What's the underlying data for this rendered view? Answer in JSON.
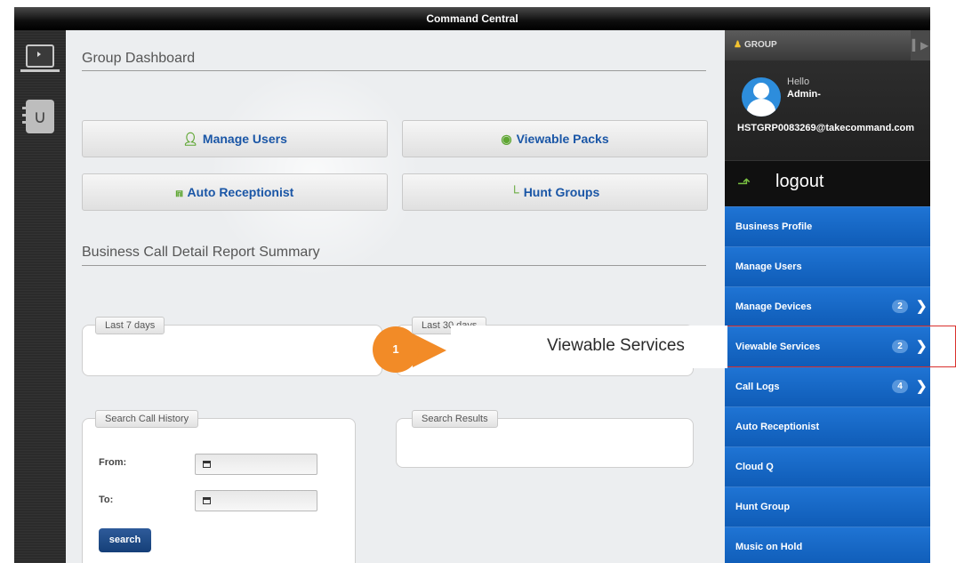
{
  "app": {
    "title": "Command Central"
  },
  "dashboard": {
    "title": "Group Dashboard",
    "buttons": [
      {
        "label": "Manage Users",
        "icon": "user-icon"
      },
      {
        "label": "Viewable Packs",
        "icon": "eye-icon"
      },
      {
        "label": "Auto Receptionist",
        "icon": "org-chart-icon"
      },
      {
        "label": "Hunt Groups",
        "icon": "hunt-group-icon"
      }
    ]
  },
  "report": {
    "title": "Business Call Detail Report Summary",
    "last7_label": "Last 7 days",
    "last30_label": "Last 30 days"
  },
  "search": {
    "panel_label": "Search Call History",
    "results_label": "Search Results",
    "from_label": "From:",
    "to_label": "To:",
    "button_label": "search"
  },
  "sidebar": {
    "header": "GROUP",
    "greeting": "Hello",
    "user_name": "Admin-",
    "email": "HSTGRP0083269@takecommand.com",
    "logout_label": "logout",
    "menu": [
      {
        "label": "Business Profile"
      },
      {
        "label": "Manage Users"
      },
      {
        "label": "Manage Devices",
        "badge": "2"
      },
      {
        "label": "Viewable Services",
        "badge": "2"
      },
      {
        "label": "Call Logs",
        "badge": "4"
      },
      {
        "label": "Auto Receptionist"
      },
      {
        "label": "Cloud Q"
      },
      {
        "label": "Hunt Group"
      },
      {
        "label": "Music on Hold"
      }
    ]
  },
  "callout": {
    "number": "1",
    "text": "Viewable Services"
  },
  "colors": {
    "accent_blue": "#1a56a6",
    "menu_blue": "#1f74d4",
    "callout_orange": "#f28b27",
    "callout_red": "#d9302c"
  }
}
